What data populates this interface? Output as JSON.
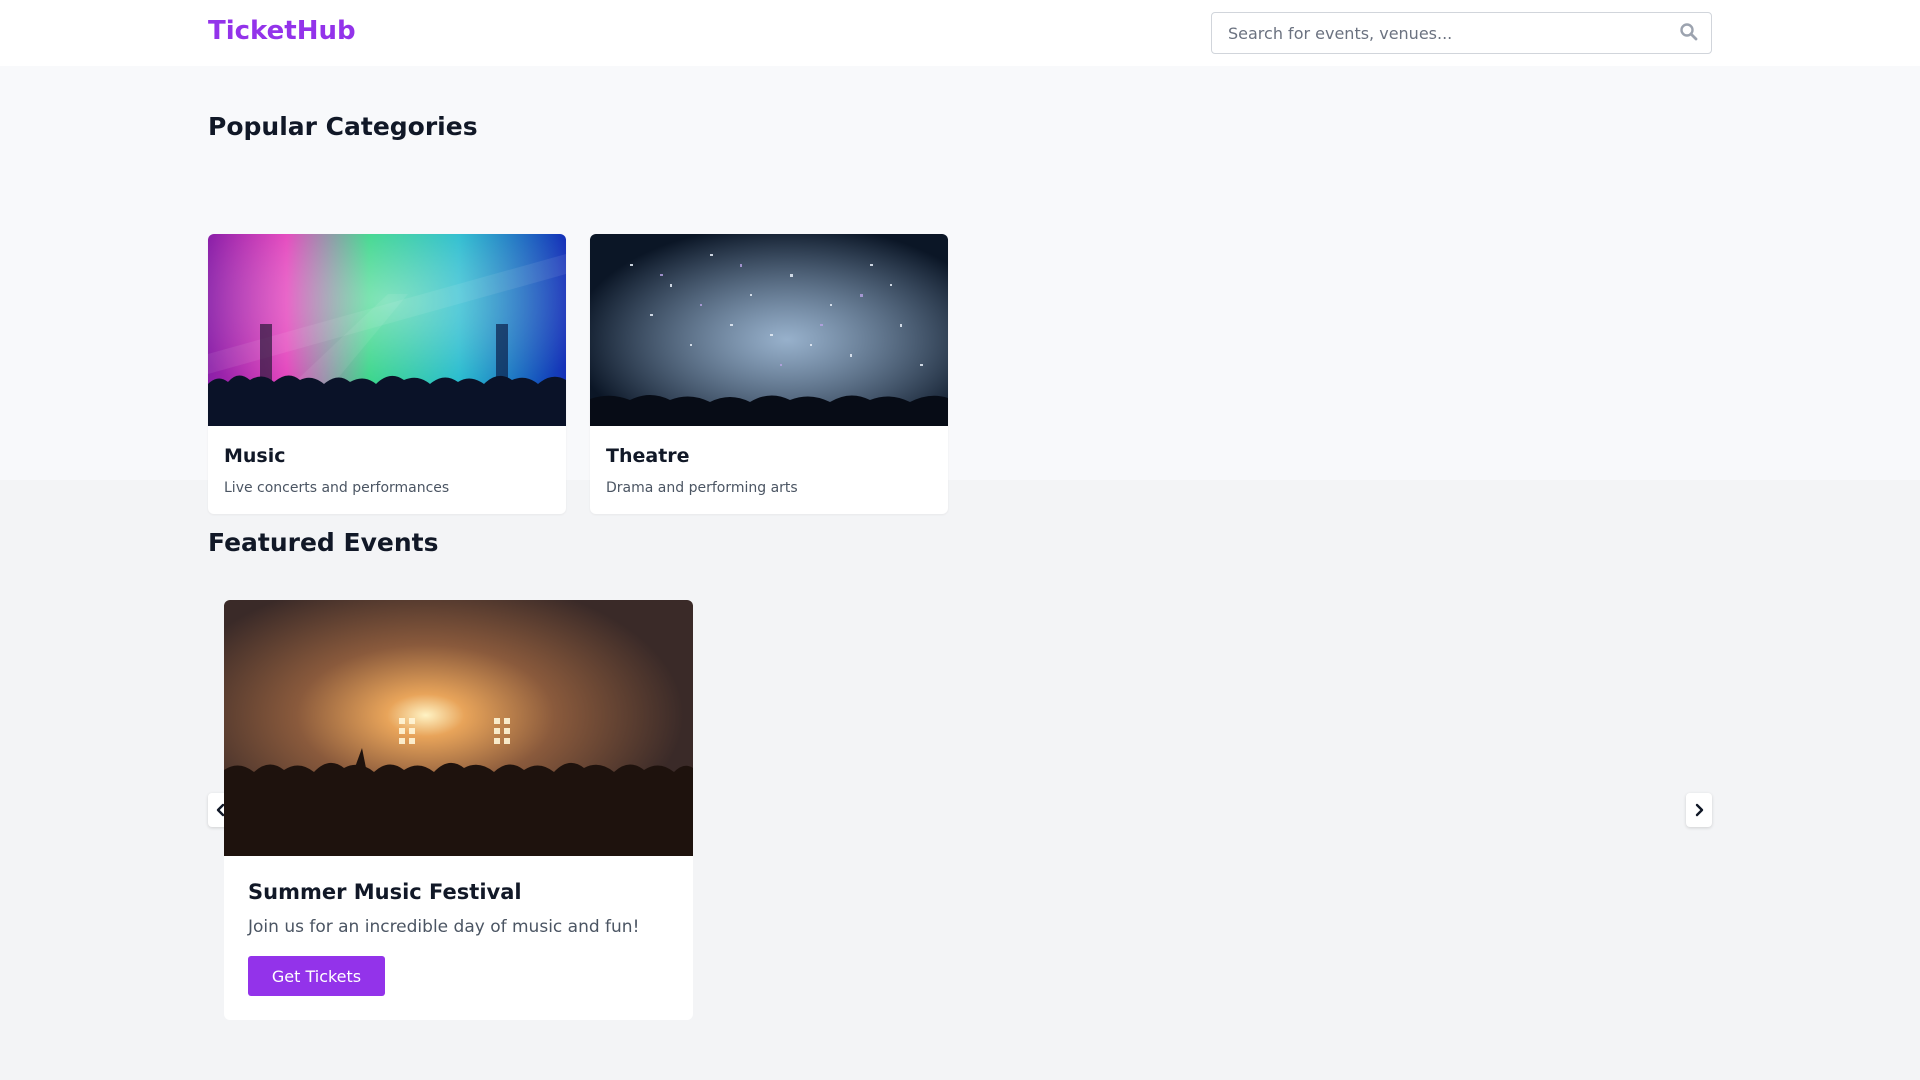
{
  "header": {
    "logo": "TicketHub",
    "search_placeholder": "Search for events, venues...",
    "search_icon": "search-icon"
  },
  "categories": {
    "title": "Popular Categories",
    "items": [
      {
        "name": "Music",
        "description": "Live concerts and performances"
      },
      {
        "name": "Theatre",
        "description": "Drama and performing arts"
      }
    ]
  },
  "featured": {
    "title": "Featured Events",
    "events": [
      {
        "title": "Summer Music Festival",
        "description": "Join us for an incredible day of music and fun!",
        "button_label": "Get Tickets"
      }
    ],
    "prev_icon": "chevron-left-icon",
    "next_icon": "chevron-right-icon"
  },
  "colors": {
    "brand": "#9333ea",
    "page_background": "#f3f4f6"
  }
}
